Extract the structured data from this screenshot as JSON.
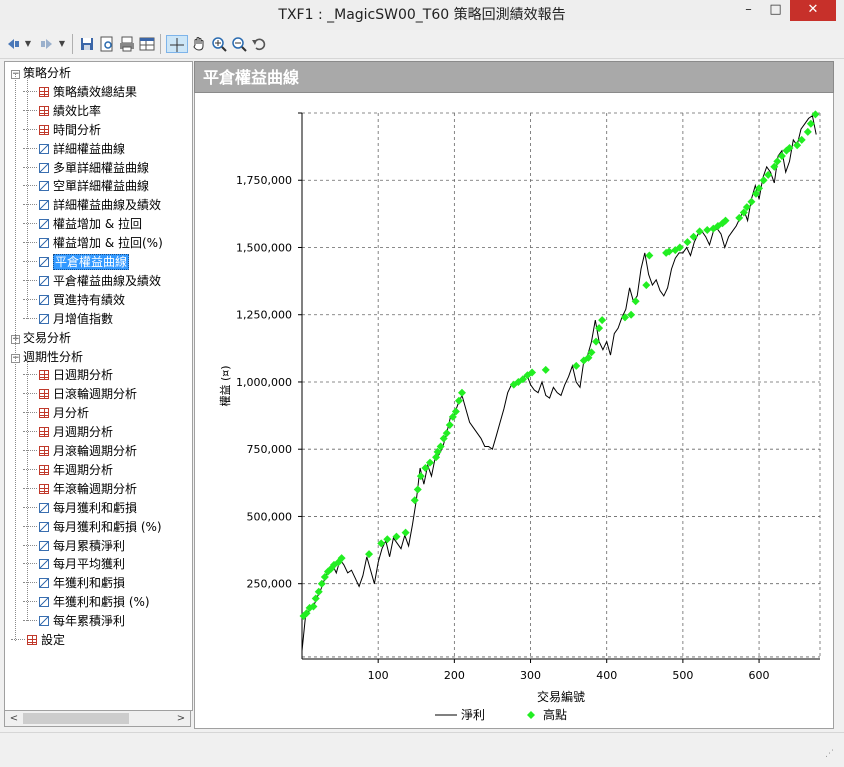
{
  "window": {
    "title": "TXF1 : _MagicSW00_T60 策略回測績效報告",
    "minimize": "–",
    "maximize": "□",
    "close": "✕"
  },
  "toolbar": {
    "icons": [
      "nav-back-icon",
      "nav-forward-icon",
      "save-icon",
      "print-preview-icon",
      "print-icon",
      "table-view-icon",
      "crosshair-icon",
      "pan-hand-icon",
      "zoom-in-icon",
      "zoom-out-icon",
      "undo-zoom-icon"
    ]
  },
  "tree": {
    "items": [
      {
        "label": "策略分析",
        "level": 0,
        "expander": "−"
      },
      {
        "label": "策略績效總結果",
        "level": 1,
        "icon": "tbl"
      },
      {
        "label": "績效比率",
        "level": 1,
        "icon": "tbl"
      },
      {
        "label": "時間分析",
        "level": 1,
        "icon": "tbl"
      },
      {
        "label": "詳細權益曲線",
        "level": 1,
        "icon": "chart"
      },
      {
        "label": "多單詳細權益曲線",
        "level": 1,
        "icon": "chart"
      },
      {
        "label": "空單詳細權益曲線",
        "level": 1,
        "icon": "chart"
      },
      {
        "label": "詳細權益曲線及績效",
        "level": 1,
        "icon": "chart"
      },
      {
        "label": "權益增加 & 拉回",
        "level": 1,
        "icon": "chart"
      },
      {
        "label": "權益增加 & 拉回(%)",
        "level": 1,
        "icon": "chart"
      },
      {
        "label": "平倉權益曲線",
        "level": 1,
        "icon": "chart",
        "selected": true
      },
      {
        "label": "平倉權益曲線及績效",
        "level": 1,
        "icon": "chart"
      },
      {
        "label": "買進持有績效",
        "level": 1,
        "icon": "chart"
      },
      {
        "label": "月增值指數",
        "level": 1,
        "icon": "chart"
      },
      {
        "label": "交易分析",
        "level": 0,
        "expander": "+"
      },
      {
        "label": "週期性分析",
        "level": 0,
        "expander": "−"
      },
      {
        "label": "日週期分析",
        "level": 1,
        "icon": "tbl"
      },
      {
        "label": "日滾輪週期分析",
        "level": 1,
        "icon": "tbl"
      },
      {
        "label": "月分析",
        "level": 1,
        "icon": "tbl"
      },
      {
        "label": "月週期分析",
        "level": 1,
        "icon": "tbl"
      },
      {
        "label": "月滾輪週期分析",
        "level": 1,
        "icon": "tbl"
      },
      {
        "label": "年週期分析",
        "level": 1,
        "icon": "tbl"
      },
      {
        "label": "年滾輪週期分析",
        "level": 1,
        "icon": "tbl"
      },
      {
        "label": "每月獲利和虧損",
        "level": 1,
        "icon": "chart"
      },
      {
        "label": "每月獲利和虧損 (%)",
        "level": 1,
        "icon": "chart"
      },
      {
        "label": "每月累積淨利",
        "level": 1,
        "icon": "chart"
      },
      {
        "label": "每月平均獲利",
        "level": 1,
        "icon": "chart"
      },
      {
        "label": "年獲利和虧損",
        "level": 1,
        "icon": "chart"
      },
      {
        "label": "年獲利和虧損 (%)",
        "level": 1,
        "icon": "chart"
      },
      {
        "label": "每年累積淨利",
        "level": 1,
        "icon": "chart"
      },
      {
        "label": "設定",
        "level": 0,
        "icon": "tbl"
      }
    ]
  },
  "panel": {
    "title": "平倉權益曲線"
  },
  "chart_data": {
    "type": "line",
    "xlabel": "交易編號",
    "ylabel": "權益 (¤)",
    "xlim": [
      0,
      680
    ],
    "ylim": [
      -30000,
      2000000
    ],
    "x_ticks": [
      100,
      200,
      300,
      400,
      500,
      600
    ],
    "x_tick_labels": [
      "100",
      "200",
      "300",
      "400",
      "500",
      "600"
    ],
    "y_ticks": [
      250000,
      500000,
      750000,
      1000000,
      1250000,
      1500000,
      1750000
    ],
    "y_tick_labels": [
      "250,000",
      "500,000",
      "750,000",
      "1,000,000",
      "1,250,000",
      "1,500,000",
      "1,750,000"
    ],
    "grid": true,
    "legend": "bottom-center",
    "legend_entries": [
      "淨利",
      "高點"
    ],
    "line_color": "#000000",
    "marker_color": "#22ee22",
    "series": [
      {
        "name": "淨利",
        "x": [
          0,
          5,
          10,
          15,
          20,
          25,
          30,
          35,
          40,
          45,
          50,
          55,
          60,
          65,
          70,
          75,
          80,
          85,
          90,
          95,
          100,
          105,
          110,
          115,
          120,
          125,
          130,
          135,
          140,
          145,
          150,
          155,
          160,
          165,
          170,
          175,
          180,
          185,
          190,
          195,
          200,
          205,
          210,
          215,
          220,
          225,
          230,
          235,
          240,
          245,
          250,
          255,
          260,
          265,
          270,
          275,
          280,
          285,
          290,
          295,
          300,
          305,
          310,
          315,
          320,
          325,
          330,
          335,
          340,
          345,
          350,
          355,
          360,
          365,
          370,
          375,
          380,
          385,
          390,
          395,
          400,
          405,
          410,
          415,
          420,
          425,
          430,
          435,
          440,
          445,
          450,
          455,
          460,
          465,
          470,
          475,
          480,
          485,
          490,
          495,
          500,
          505,
          510,
          515,
          520,
          525,
          530,
          535,
          540,
          545,
          550,
          555,
          560,
          565,
          570,
          575,
          580,
          585,
          590,
          595,
          600,
          605,
          610,
          615,
          620,
          625,
          630,
          635,
          640,
          645,
          650,
          655,
          660,
          665,
          670,
          675
        ],
        "y": [
          0,
          140000,
          150000,
          165000,
          200000,
          230000,
          270000,
          300000,
          320000,
          290000,
          340000,
          320000,
          290000,
          300000,
          270000,
          240000,
          280000,
          350000,
          300000,
          250000,
          330000,
          380000,
          410000,
          350000,
          420000,
          400000,
          380000,
          430000,
          390000,
          470000,
          560000,
          680000,
          620000,
          690000,
          650000,
          720000,
          730000,
          760000,
          810000,
          870000,
          880000,
          920000,
          950000,
          900000,
          850000,
          830000,
          810000,
          790000,
          760000,
          760000,
          750000,
          800000,
          850000,
          900000,
          960000,
          990000,
          1000000,
          1000000,
          1010000,
          1030000,
          990000,
          970000,
          960000,
          1000000,
          950000,
          940000,
          980000,
          960000,
          950000,
          990000,
          1020000,
          1060000,
          1000000,
          980000,
          1080000,
          1100000,
          1150000,
          1230000,
          1150000,
          1120000,
          1150000,
          1100000,
          1180000,
          1200000,
          1240000,
          1270000,
          1350000,
          1300000,
          1320000,
          1420000,
          1480000,
          1400000,
          1360000,
          1380000,
          1340000,
          1320000,
          1350000,
          1420000,
          1460000,
          1480000,
          1480000,
          1500000,
          1470000,
          1520000,
          1550000,
          1560000,
          1540000,
          1510000,
          1560000,
          1570000,
          1550000,
          1500000,
          1540000,
          1560000,
          1580000,
          1610000,
          1640000,
          1600000,
          1680000,
          1730000,
          1680000,
          1760000,
          1800000,
          1780000,
          1740000,
          1840000,
          1860000,
          1780000,
          1820000,
          1900000,
          1880000,
          1940000,
          1960000,
          1980000,
          1990000,
          1920000
        ]
      },
      {
        "name": "高點",
        "x": [
          2,
          6,
          10,
          15,
          18,
          22,
          26,
          30,
          34,
          38,
          42,
          48,
          52,
          88,
          104,
          112,
          124,
          136,
          148,
          152,
          156,
          162,
          168,
          176,
          178,
          182,
          186,
          190,
          194,
          198,
          202,
          206,
          210,
          278,
          284,
          290,
          296,
          302,
          320,
          360,
          370,
          376,
          380,
          386,
          390,
          394,
          424,
          432,
          438,
          452,
          456,
          478,
          482,
          490,
          496,
          506,
          514,
          522,
          532,
          540,
          546,
          552,
          556,
          574,
          580,
          584,
          590,
          596,
          600,
          606,
          612,
          620,
          624,
          630,
          636,
          640,
          650,
          656,
          664,
          668,
          674
        ],
        "y": [
          130000,
          140000,
          160000,
          165000,
          195000,
          220000,
          250000,
          275000,
          295000,
          305000,
          320000,
          330000,
          345000,
          360000,
          400000,
          415000,
          425000,
          440000,
          560000,
          600000,
          650000,
          680000,
          700000,
          720000,
          740000,
          760000,
          790000,
          810000,
          840000,
          870000,
          890000,
          930000,
          960000,
          990000,
          1000000,
          1010000,
          1025000,
          1035000,
          1045000,
          1060000,
          1080000,
          1090000,
          1110000,
          1150000,
          1200000,
          1230000,
          1240000,
          1250000,
          1300000,
          1360000,
          1470000,
          1480000,
          1485000,
          1490000,
          1500000,
          1520000,
          1540000,
          1560000,
          1565000,
          1570000,
          1580000,
          1590000,
          1600000,
          1610000,
          1630000,
          1650000,
          1670000,
          1700000,
          1720000,
          1750000,
          1770000,
          1800000,
          1820000,
          1840000,
          1860000,
          1870000,
          1880000,
          1900000,
          1930000,
          1960000,
          1995000
        ]
      }
    ]
  }
}
